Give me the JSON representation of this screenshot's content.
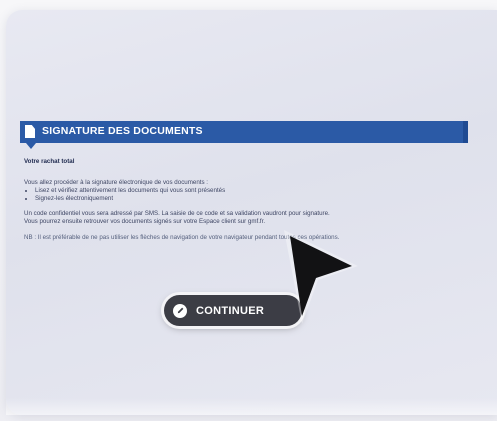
{
  "header": {
    "title": "SIGNATURE DES DOCUMENTS",
    "icon": "document-icon"
  },
  "content": {
    "subtitle": "Votre rachat total",
    "intro": "Vous allez procéder à la signature électronique de vos documents :",
    "bullets": [
      "Lisez et vérifiez attentivement les documents qui vous sont présentés",
      "Signez-les électroniquement"
    ],
    "sms_line": "Un code confidentiel vous sera adressé par SMS. La saisie de ce code et sa validation vaudront pour signature.",
    "retrieve_line": "Vous pourrez ensuite retrouver vos documents signés sur votre Espace client sur gmf.fr.",
    "nb_line": "NB : Il est préférable de ne pas utiliser les flèches de navigation de votre navigateur pendant toutes ces opérations."
  },
  "button": {
    "label": "CONTINUER",
    "icon": "pencil-icon"
  },
  "colors": {
    "header_bg": "#2b5aa6",
    "button_bg": "#3c3d45",
    "panel_bg": "#e3e5ef"
  }
}
